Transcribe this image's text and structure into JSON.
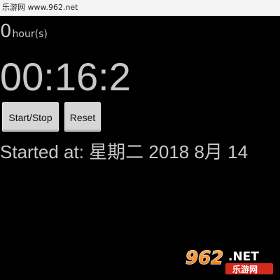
{
  "watermark": {
    "text": "乐游网 www.962.net"
  },
  "stopwatch": {
    "hours_value": "0",
    "hours_unit": "hour(s)",
    "time": "00:16:2",
    "started_text": "Started at: 星期二 2018 8月 14"
  },
  "buttons": {
    "start_stop": "Start/Stop",
    "reset": "Reset"
  },
  "logo": {
    "number_text": "962",
    "suffix_text": ".NET",
    "chinese_text": "乐游网"
  },
  "colors": {
    "background": "#000000",
    "text": "#c8c8c8",
    "button": "#d6d6d6",
    "status_bar": "#f4f4f4",
    "logo_orange": "#f08a1c",
    "logo_red": "#d42a1e"
  }
}
